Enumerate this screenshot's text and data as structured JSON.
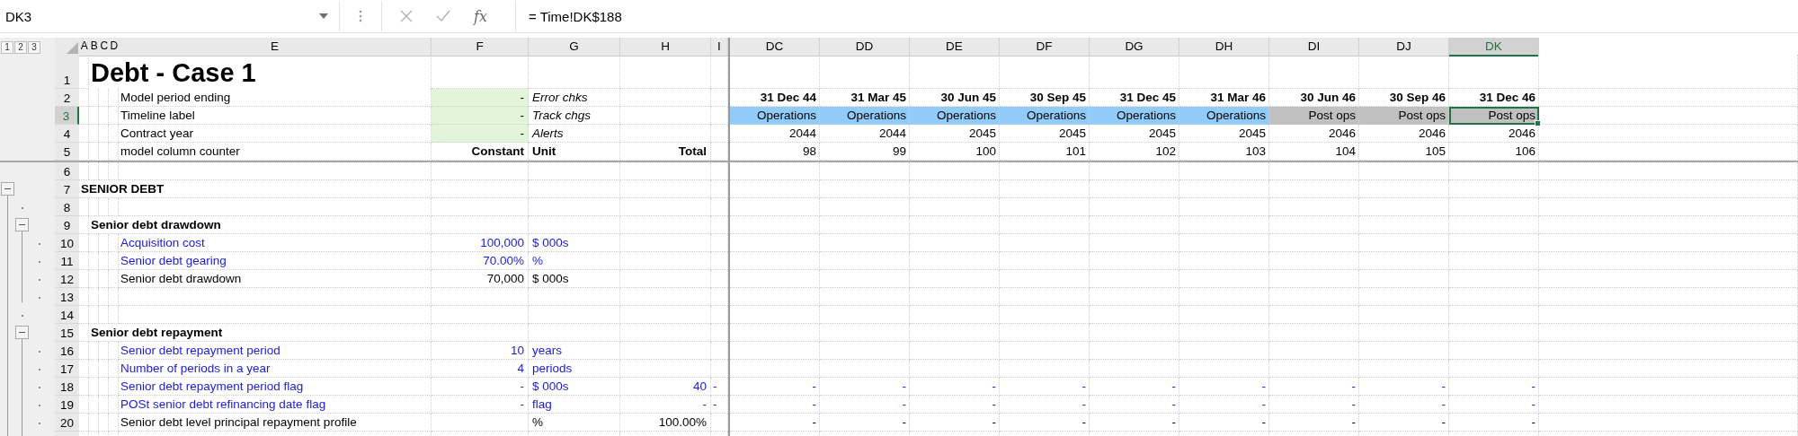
{
  "formula_bar": {
    "name_box": "DK3",
    "function_label": "fx",
    "formula": "= Time!DK$188"
  },
  "outline_levels": [
    "1",
    "2",
    "3"
  ],
  "left_columns": [
    {
      "label": "A",
      "selected": false
    },
    {
      "label": "B",
      "selected": false
    },
    {
      "label": "C",
      "selected": false
    },
    {
      "label": "D",
      "selected": false
    },
    {
      "label": "E",
      "selected": false
    },
    {
      "label": "F",
      "selected": false
    },
    {
      "label": "G",
      "selected": false
    },
    {
      "label": "H",
      "selected": false
    },
    {
      "label": "I",
      "selected": false
    }
  ],
  "timeline_columns": [
    {
      "label": "DC",
      "selected": false
    },
    {
      "label": "DD",
      "selected": false
    },
    {
      "label": "DE",
      "selected": false
    },
    {
      "label": "DF",
      "selected": false
    },
    {
      "label": "DG",
      "selected": false
    },
    {
      "label": "DH",
      "selected": false
    },
    {
      "label": "DI",
      "selected": false
    },
    {
      "label": "DJ",
      "selected": false
    },
    {
      "label": "DK",
      "selected": true
    }
  ],
  "rows": [
    {
      "number": "1",
      "selected": false,
      "kind": "title",
      "label": "Debt - Case 1"
    },
    {
      "number": "2",
      "selected": false,
      "kind": "dates",
      "label": "Model period ending",
      "constant": "-",
      "unit": "Error chks",
      "timeline": [
        {
          "text": "31 Dec 44"
        },
        {
          "text": "31 Mar 45"
        },
        {
          "text": "30 Jun 45"
        },
        {
          "text": "30 Sep 45"
        },
        {
          "text": "31 Dec 45"
        },
        {
          "text": "31 Mar 46"
        },
        {
          "text": "30 Jun 46"
        },
        {
          "text": "30 Sep 46"
        },
        {
          "text": "31 Dec 46"
        }
      ]
    },
    {
      "number": "3",
      "selected": true,
      "kind": "labels",
      "label": "Timeline label",
      "constant": "-",
      "unit": "Track chgs",
      "timeline": [
        {
          "text": "Operations",
          "color": "#92cbf8",
          "selected": false
        },
        {
          "text": "Operations",
          "color": "#92cbf8",
          "selected": false
        },
        {
          "text": "Operations",
          "color": "#92cbf8",
          "selected": false
        },
        {
          "text": "Operations",
          "color": "#92cbf8",
          "selected": false
        },
        {
          "text": "Operations",
          "color": "#92cbf8",
          "selected": false
        },
        {
          "text": "Operations",
          "color": "#92cbf8",
          "selected": false
        },
        {
          "text": "Post ops",
          "color": "#c0c0c0",
          "selected": false
        },
        {
          "text": "Post ops",
          "color": "#c0c0c0",
          "selected": false
        },
        {
          "text": "Post ops",
          "color": "#c0c0c0",
          "selected": true
        }
      ]
    },
    {
      "number": "4",
      "selected": false,
      "kind": "meta",
      "label": "Contract year",
      "constant": "-",
      "unit": "Alerts",
      "timeline": [
        {
          "text": "2044"
        },
        {
          "text": "2044"
        },
        {
          "text": "2045"
        },
        {
          "text": "2045"
        },
        {
          "text": "2045"
        },
        {
          "text": "2045"
        },
        {
          "text": "2046"
        },
        {
          "text": "2046"
        },
        {
          "text": "2046"
        }
      ]
    },
    {
      "number": "5",
      "selected": false,
      "kind": "heads",
      "label": "model column counter",
      "constant": "Constant",
      "unit": "Unit",
      "total": "Total",
      "timeline": [
        {
          "text": "98"
        },
        {
          "text": "99"
        },
        {
          "text": "100"
        },
        {
          "text": "101"
        },
        {
          "text": "102"
        },
        {
          "text": "103"
        },
        {
          "text": "104"
        },
        {
          "text": "105"
        },
        {
          "text": "106"
        }
      ]
    },
    {
      "number": "6",
      "selected": false,
      "kind": "blank"
    },
    {
      "number": "7",
      "selected": false,
      "kind": "section",
      "label": "SENIOR DEBT",
      "outline": {
        "kind": "group"
      }
    },
    {
      "number": "8",
      "selected": false,
      "kind": "blank",
      "outline": {
        "kind": "item"
      }
    },
    {
      "number": "9",
      "selected": false,
      "kind": "subsection",
      "label": "Senior debt drawdown",
      "outline": {
        "kind": "subgroup"
      }
    },
    {
      "number": "10",
      "selected": false,
      "kind": "item",
      "input": true,
      "label": "Acquisition cost",
      "constant": "100,000",
      "unit": "$ 000s",
      "outline": {
        "kind": "subitem"
      }
    },
    {
      "number": "11",
      "selected": false,
      "kind": "item",
      "input": true,
      "label": "Senior debt gearing",
      "constant": "70.00%",
      "unit": "%",
      "outline": {
        "kind": "subitem"
      }
    },
    {
      "number": "12",
      "selected": false,
      "kind": "item",
      "input": false,
      "label": "Senior debt drawdown",
      "constant": "70,000",
      "unit": "$ 000s",
      "outline": {
        "kind": "subitem"
      }
    },
    {
      "number": "13",
      "selected": false,
      "kind": "blank",
      "outline": {
        "kind": "subitem"
      }
    },
    {
      "number": "14",
      "selected": false,
      "kind": "blank",
      "outline": {
        "kind": "item"
      }
    },
    {
      "number": "15",
      "selected": false,
      "kind": "subsection",
      "label": "Senior debt repayment",
      "outline": {
        "kind": "subgroup"
      }
    },
    {
      "number": "16",
      "selected": false,
      "kind": "item",
      "input": true,
      "label": "Senior debt repayment period",
      "constant": "10",
      "unit": "years",
      "outline": {
        "kind": "subitem"
      }
    },
    {
      "number": "17",
      "selected": false,
      "kind": "item",
      "input": true,
      "label": "Number of periods in a year",
      "constant": "4",
      "unit": "periods",
      "outline": {
        "kind": "subitem"
      }
    },
    {
      "number": "18",
      "selected": false,
      "kind": "item",
      "input": true,
      "label": "Senior debt repayment period flag",
      "constant": "-",
      "unit": "$ 000s",
      "total": "40",
      "col_i": "-",
      "outline": {
        "kind": "subitem"
      },
      "timeline": [
        {
          "text": "-"
        },
        {
          "text": "-"
        },
        {
          "text": "-"
        },
        {
          "text": "-"
        },
        {
          "text": "-"
        },
        {
          "text": "-"
        },
        {
          "text": "-"
        },
        {
          "text": "-"
        },
        {
          "text": "-"
        }
      ]
    },
    {
      "number": "19",
      "selected": false,
      "kind": "item",
      "input": true,
      "label": "POSt senior debt refinancing date flag",
      "constant": "-",
      "unit": "flag",
      "total": "-",
      "col_i": "-",
      "outline": {
        "kind": "subitem"
      },
      "timeline": [
        {
          "text": "-"
        },
        {
          "text": "-"
        },
        {
          "text": "-"
        },
        {
          "text": "-"
        },
        {
          "text": "-"
        },
        {
          "text": "-"
        },
        {
          "text": "-"
        },
        {
          "text": "-"
        },
        {
          "text": "-"
        }
      ]
    },
    {
      "number": "20",
      "selected": false,
      "kind": "item",
      "input": false,
      "label": "Senior debt level principal repayment profile",
      "unit": "%",
      "total": "100.00%",
      "outline": {
        "kind": "subitem"
      },
      "timeline": [
        {
          "text": "-"
        },
        {
          "text": "-"
        },
        {
          "text": "-"
        },
        {
          "text": "-"
        },
        {
          "text": "-"
        },
        {
          "text": "-"
        },
        {
          "text": "-"
        },
        {
          "text": "-"
        },
        {
          "text": "-"
        }
      ]
    }
  ]
}
